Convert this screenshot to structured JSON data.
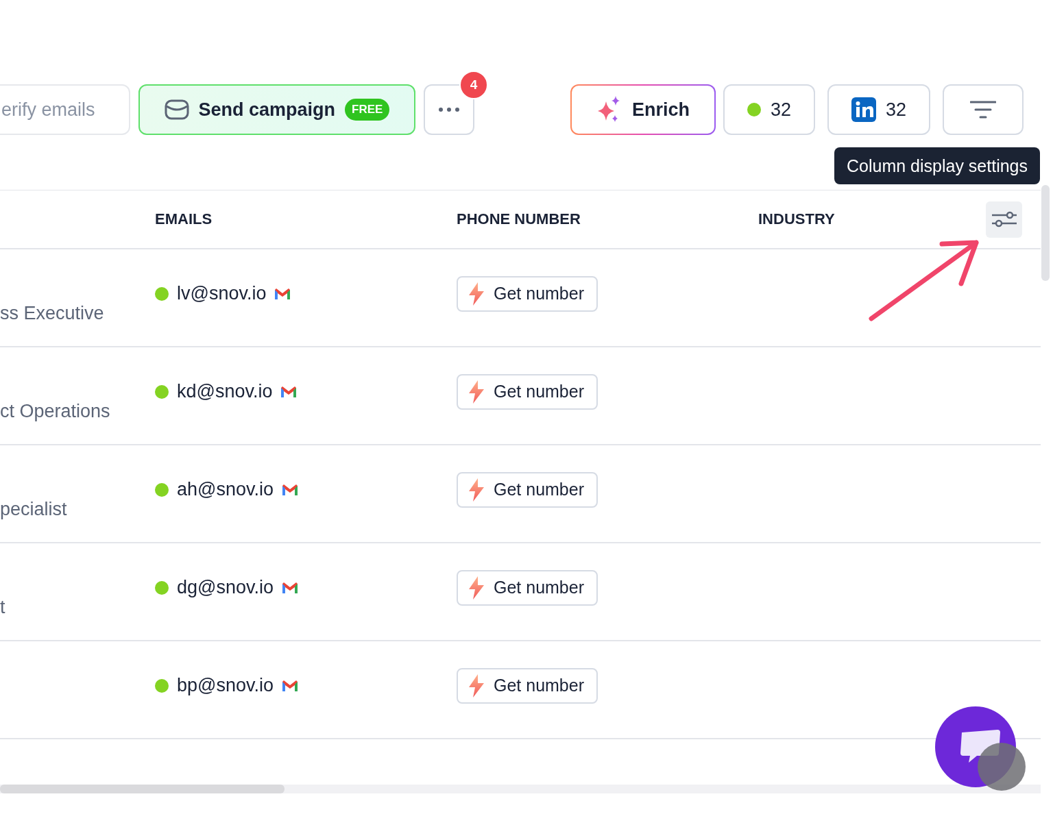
{
  "toolbar": {
    "verify_button": "erify emails",
    "send_campaign": {
      "label": "Send campaign",
      "badge": "FREE"
    },
    "more_button": {
      "badge": "4"
    },
    "enrich_button": "Enrich",
    "verified_count": "32",
    "linkedin_count": "32"
  },
  "tooltip": "Column display settings",
  "table": {
    "columns": [
      "EMAILS",
      "PHONE NUMBER",
      "INDUSTRY"
    ],
    "rows": [
      {
        "title": "ss Executive",
        "email": "lv@snov.io",
        "phone_action": "Get number"
      },
      {
        "title": "ct Operations",
        "email": "kd@snov.io",
        "phone_action": "Get number"
      },
      {
        "title": "pecialist",
        "email": "ah@snov.io",
        "phone_action": "Get number"
      },
      {
        "title": "t",
        "email": "dg@snov.io",
        "phone_action": "Get number"
      },
      {
        "email": "bp@snov.io",
        "phone_action": "Get number"
      }
    ]
  }
}
